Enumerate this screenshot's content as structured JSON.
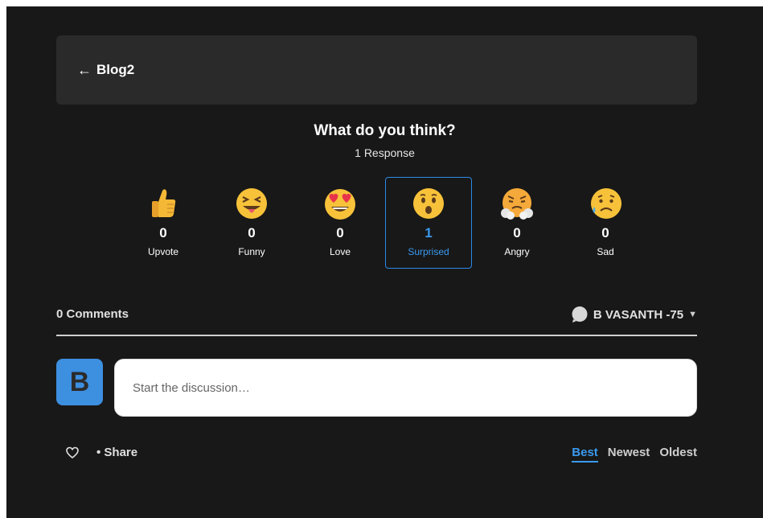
{
  "header": {
    "back_label": "Blog2"
  },
  "reactions_section": {
    "question": "What do you think?",
    "responses": "1 Response",
    "items": [
      {
        "label": "Upvote",
        "count": "0",
        "icon": "thumbs-up-icon",
        "selected": false
      },
      {
        "label": "Funny",
        "count": "0",
        "icon": "laughing-face-icon",
        "selected": false
      },
      {
        "label": "Love",
        "count": "0",
        "icon": "heart-eyes-face-icon",
        "selected": false
      },
      {
        "label": "Surprised",
        "count": "1",
        "icon": "surprised-face-icon",
        "selected": true
      },
      {
        "label": "Angry",
        "count": "0",
        "icon": "angry-face-icon",
        "selected": false
      },
      {
        "label": "Sad",
        "count": "0",
        "icon": "sad-face-icon",
        "selected": false
      }
    ]
  },
  "comments": {
    "count_label": "0 Comments",
    "user_name": "B VASANTH -75",
    "caret": "▼",
    "avatar_letter": "B",
    "input_placeholder": "Start the discussion…"
  },
  "footer": {
    "share_label": "• Share",
    "sort_options": [
      "Best",
      "Newest",
      "Oldest"
    ],
    "active_sort": "Best"
  },
  "colors": {
    "background": "#181818",
    "header_bg": "#2a2a2a",
    "accent": "#3a9af0",
    "avatar_bg": "#3d8fe0"
  }
}
